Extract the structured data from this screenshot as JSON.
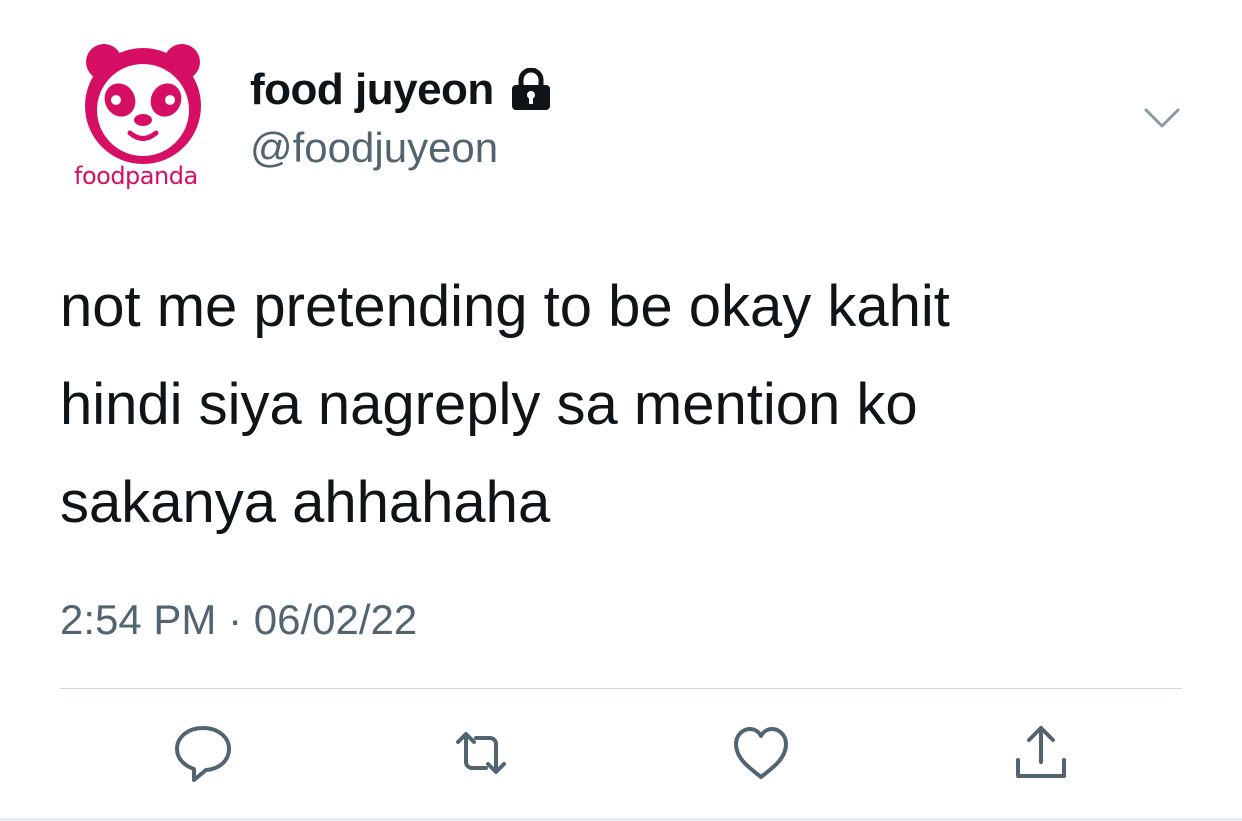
{
  "user": {
    "display_name": "food juyeon",
    "handle": "@foodjuyeon",
    "avatar_brand_text": "foodpanda",
    "avatar_color": "#d70f64",
    "protected_icon": "lock-icon"
  },
  "tweet": {
    "text_lines": [
      "not me pretending to be okay kahit",
      "hindi siya nagreply sa mention ko",
      "sakanya ahhahaha"
    ],
    "timestamp": "2:54 PM · 06/02/22"
  },
  "actions": [
    {
      "name": "reply",
      "icon": "speech-bubble-icon"
    },
    {
      "name": "retweet",
      "icon": "retweet-icon"
    },
    {
      "name": "like",
      "icon": "heart-icon"
    },
    {
      "name": "share",
      "icon": "share-icon"
    }
  ],
  "colors": {
    "text": "#0f1419",
    "secondary": "#536471",
    "divider": "#cfd9de",
    "brand": "#d70f64"
  }
}
